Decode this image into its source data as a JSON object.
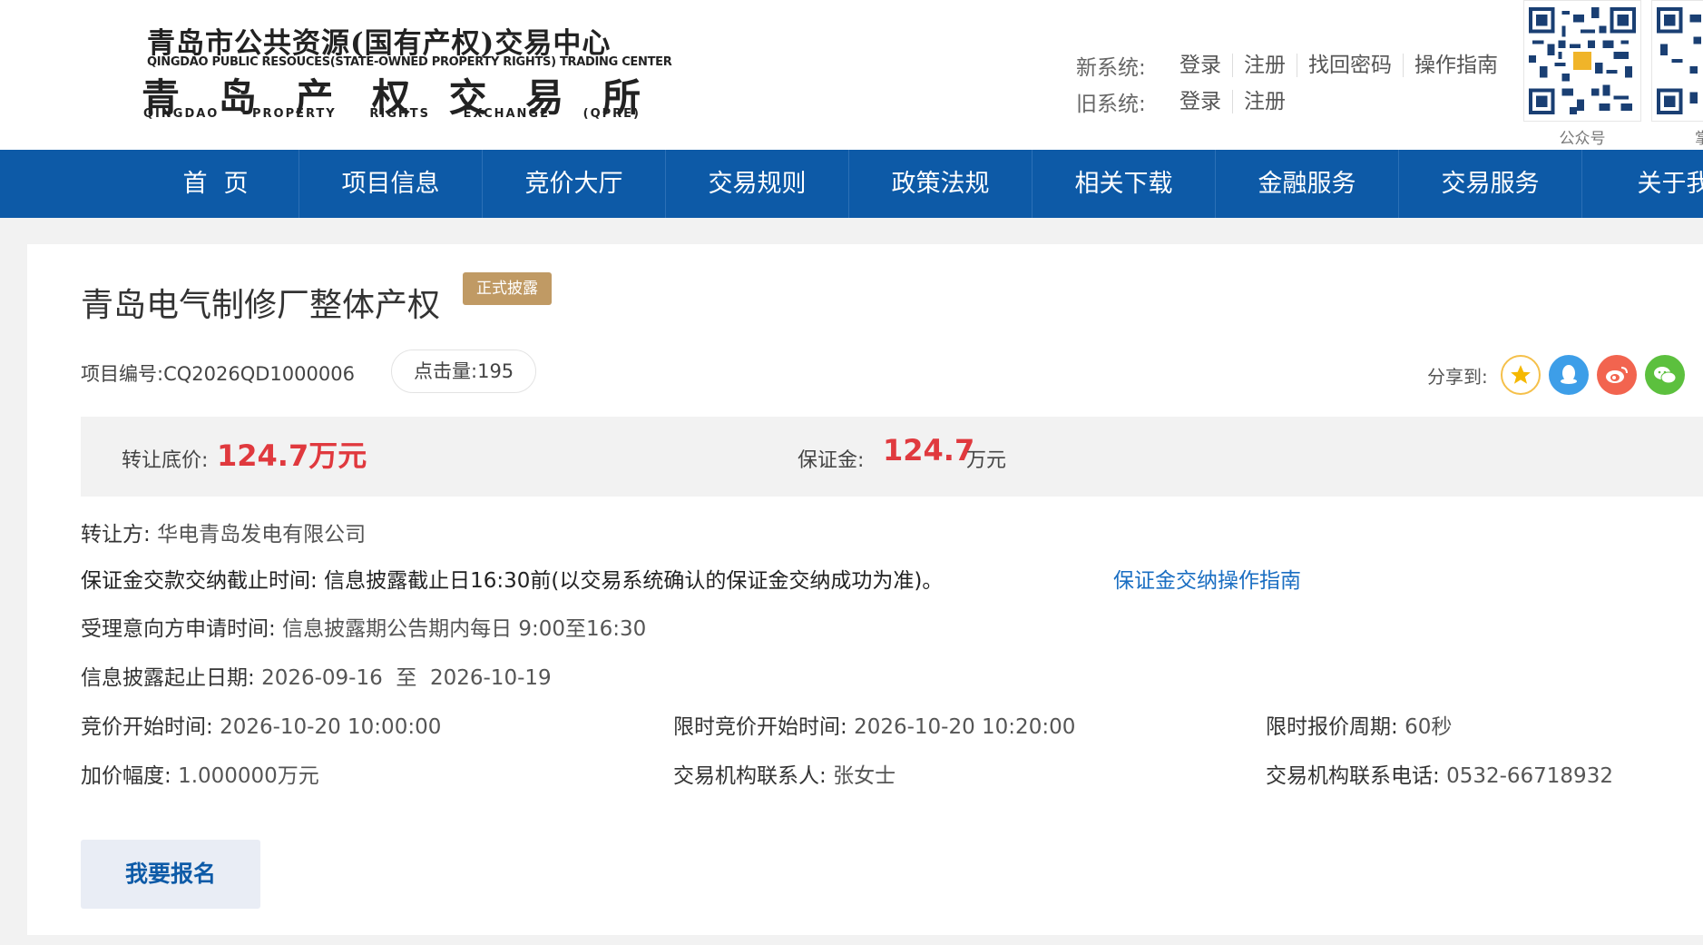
{
  "header": {
    "logo": {
      "cn_top": "青岛市公共资源(国有产权)交易中心",
      "en_top": "QINGDAO PUBLIC RESOUCES(STATE-OWNED PROPERTY RIGHTS) TRADING CENTER",
      "cn_big": [
        "青",
        "岛",
        "产",
        "权",
        "交",
        "易",
        "所"
      ],
      "en_big": [
        "QINGDAO",
        "PROPERTY",
        "RIGHTS",
        "EXCHANGE",
        "(QPRE)"
      ]
    },
    "new_system": {
      "label": "新系统:",
      "links": [
        "登录",
        "注册",
        "找回密码",
        "操作指南"
      ]
    },
    "old_system": {
      "label": "旧系统:",
      "links": [
        "登录",
        "注册"
      ]
    },
    "qrcodes": [
      {
        "caption": "公众号"
      },
      {
        "caption": "掌上"
      }
    ]
  },
  "nav": {
    "items": [
      "首页",
      "项目信息",
      "竞价大厅",
      "交易规则",
      "政策法规",
      "相关下载",
      "金融服务",
      "交易服务",
      "关于我"
    ]
  },
  "project": {
    "title": "青岛电气制修厂整体产权",
    "status_tag": "正式披露",
    "number_label": "项目编号:",
    "number": "CQ2026QD1000006",
    "views_label": "点击量:",
    "views": "195",
    "share_label": "分享到:",
    "share_icons": [
      "qzone-star-icon",
      "qq-icon",
      "weibo-icon",
      "wechat-icon"
    ],
    "reserve_price_label": "转让底价:",
    "reserve_price": "124.7万元",
    "deposit_label": "保证金:",
    "deposit_value": "124.7",
    "deposit_unit": "万元",
    "transferor_label": "转让方:",
    "transferor": "华电青岛发电有限公司",
    "deposit_deadline_label": "保证金交款交纳截止时间:",
    "deposit_deadline": "信息披露截止日16:30前(以交易系统确认的保证金交纳成功为准)。",
    "deposit_guide_link": "保证金交纳操作指南",
    "application_time_label": "受理意向方申请时间:",
    "application_time": "信息披露期公告期内每日 9:00至16:30",
    "disclosure_period_label": "信息披露起止日期:",
    "disclosure_period": "2026-09-16  至  2026-10-19",
    "bid_start_label": "竞价开始时间:",
    "bid_start": "2026-10-20 10:00:00",
    "timed_bid_start_label": "限时竞价开始时间:",
    "timed_bid_start": "2026-10-20 10:20:00",
    "timed_cycle_label": "限时报价周期:",
    "timed_cycle": "60秒",
    "increment_label": "加价幅度:",
    "increment": "1.000000万元",
    "contact_label": "交易机构联系人:",
    "contact": "张女士",
    "phone_label": "交易机构联系电话:",
    "phone": "0532-66718932",
    "signup_button": "我要报名"
  },
  "colors": {
    "nav_bg": "#0d5aa7",
    "tag_bg": "#c09a64",
    "price_red": "#e0393e",
    "link_blue": "#1a6ec2"
  }
}
